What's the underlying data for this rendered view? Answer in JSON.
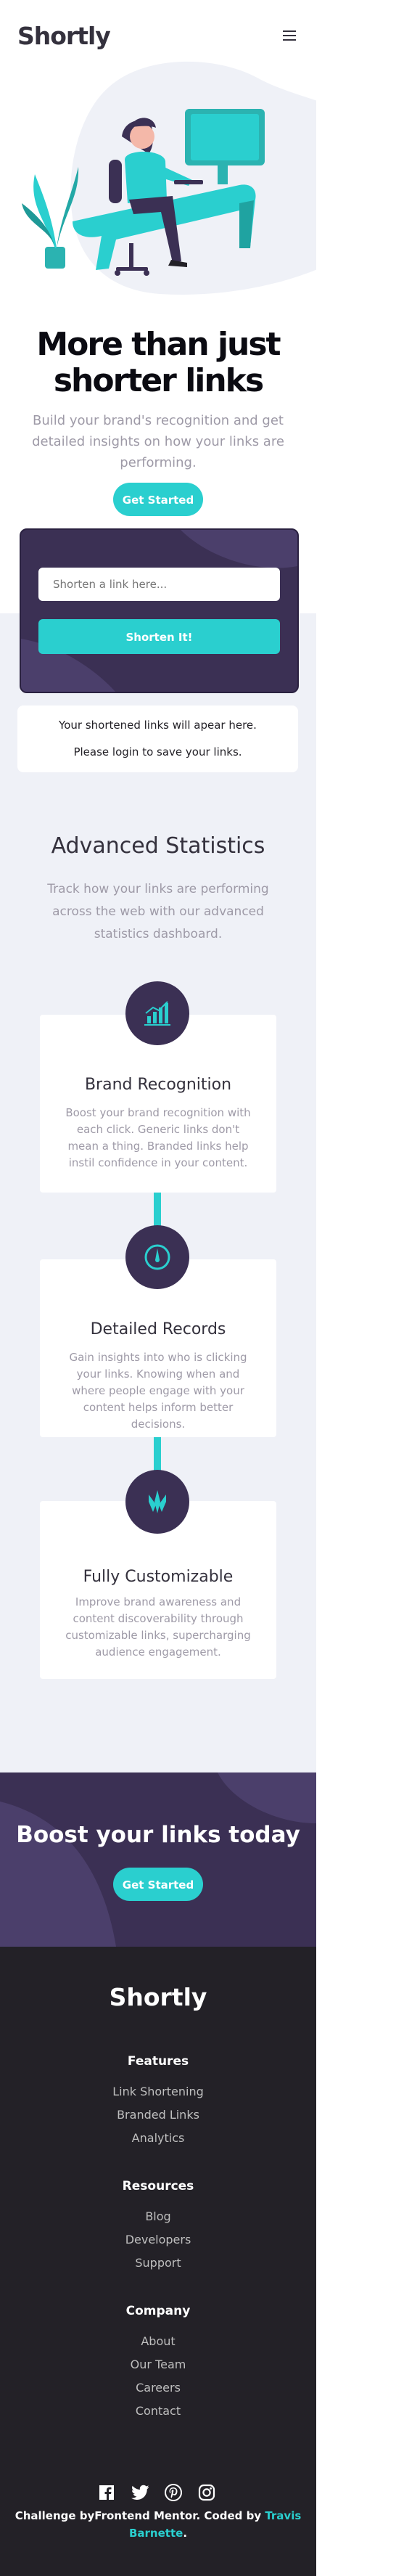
{
  "header": {
    "logo": "Shortly",
    "menu_icon": "hamburger-menu-icon"
  },
  "hero": {
    "title_line1": "More than just",
    "title_line2": "shorter links",
    "subtitle": "Build your brand's recognition and get detailed insights on how your links are performing.",
    "cta": "Get Started",
    "illustration": "person-working-at-desk-illustration"
  },
  "shorten": {
    "placeholder": "Shorten a link here...",
    "button": "Shorten It!"
  },
  "result": {
    "line1": "Your shortened links will apear here.",
    "line2": "Please login to save your links."
  },
  "stats": {
    "title": "Advanced Statistics",
    "subtitle": "Track how your links are performing across the web with our advanced statistics dashboard.",
    "features": [
      {
        "icon": "brand-recognition-icon",
        "title": "Brand Recognition",
        "text": "Boost your brand recognition with each click. Generic links don't mean a thing. Branded links help instil confidence in your content."
      },
      {
        "icon": "detailed-records-icon",
        "title": "Detailed Records",
        "text": "Gain insights into who is clicking your links. Knowing when and where people engage with your content helps inform better decisions."
      },
      {
        "icon": "fully-customizable-icon",
        "title": "Fully Customizable",
        "text": "Improve brand awareness and content discoverability through customizable links, supercharging audience engagement."
      }
    ]
  },
  "boost": {
    "title": "Boost your links today",
    "cta": "Get Started"
  },
  "footer": {
    "logo": "Shortly",
    "columns": [
      {
        "heading": "Features",
        "links": [
          "Link Shortening",
          "Branded Links",
          "Analytics"
        ]
      },
      {
        "heading": "Resources",
        "links": [
          "Blog",
          "Developers",
          "Support"
        ]
      },
      {
        "heading": "Company",
        "links": [
          "About",
          "Our Team",
          "Careers",
          "Contact"
        ]
      }
    ],
    "socials": [
      "facebook-icon",
      "twitter-icon",
      "pinterest-icon",
      "instagram-icon"
    ],
    "credit_prefix": "Challenge byFrontend Mentor. Coded by ",
    "credit_author": "Travis Barnette",
    "credit_suffix": "."
  },
  "colors": {
    "cyan": "#2acfcf",
    "dark_violet": "#3b3054",
    "very_dark_violet": "#232127",
    "gray_bg": "#eff1f7",
    "grayish_violet": "#9e9aa7"
  }
}
